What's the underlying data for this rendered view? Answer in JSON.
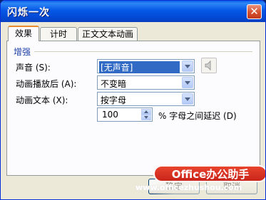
{
  "window": {
    "title": "闪烁一次"
  },
  "tabs": [
    "效果",
    "计时",
    "正文文本动画"
  ],
  "group": {
    "title": "增强"
  },
  "fields": {
    "sound": {
      "label": "声音 (S):",
      "value": "[无声音]"
    },
    "after_animation": {
      "label": "动画播放后 (A):",
      "value": "不变暗"
    },
    "animate_text": {
      "label": "动画文本 (X):",
      "value": "按字母"
    },
    "delay": {
      "value": "100",
      "suffix": "% 字母之间延迟 (D)"
    }
  },
  "buttons": {
    "ok": "确定",
    "cancel": "取消"
  },
  "watermark": {
    "logo": "Office办公助手",
    "url": "www.officezhushou.com"
  },
  "icons": {
    "close": "close-icon",
    "speaker": "speaker-icon",
    "dropdown": "chevron-down-icon"
  },
  "colors": {
    "titlebar": "#0558e6",
    "selection": "#316ac5",
    "tab_accent": "#e68b2c",
    "watermark": "#d6321f"
  }
}
